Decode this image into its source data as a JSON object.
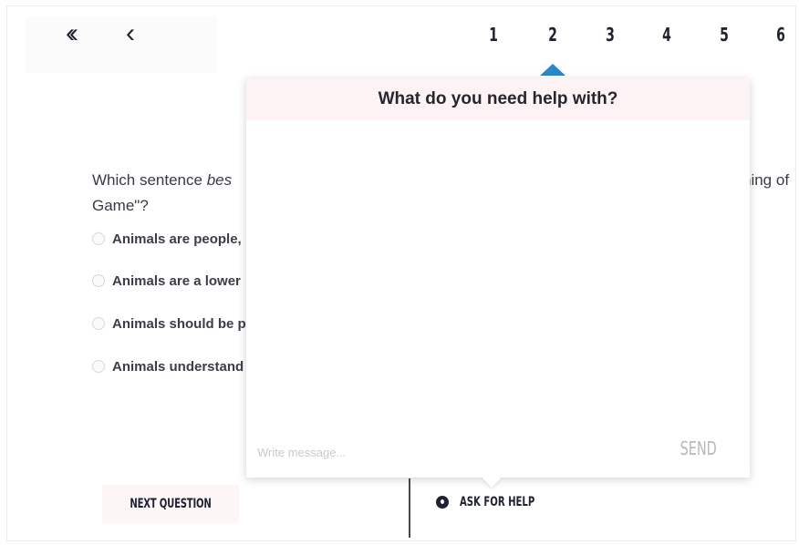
{
  "nav": {
    "first_icon": "double-chevron-left-icon",
    "prev_icon": "chevron-left-icon",
    "question_numbers": [
      "1",
      "2",
      "3",
      "4",
      "5",
      "6"
    ],
    "active_question": "2"
  },
  "question": {
    "text_head": "Which sentence ",
    "text_emph": "bes",
    "text_tail": "ning of",
    "text_line2": "Game\"?"
  },
  "options": [
    {
      "label": "Animals are people,"
    },
    {
      "label": "Animals are a lower"
    },
    {
      "label": "Animals should be p"
    },
    {
      "label": "Animals understand"
    }
  ],
  "footer": {
    "next_label": "NEXT QUESTION",
    "ask_help_label": "ASK FOR HELP",
    "ask_help_icon": "help-dot-icon"
  },
  "help_popup": {
    "title": "What do you need help with?",
    "message_placeholder": "Write message...",
    "send_label": "SEND"
  },
  "colors": {
    "accent_caret": "#2a86c8",
    "popup_header_bg": "#fdf3f5",
    "text_dark": "#1f2230"
  }
}
